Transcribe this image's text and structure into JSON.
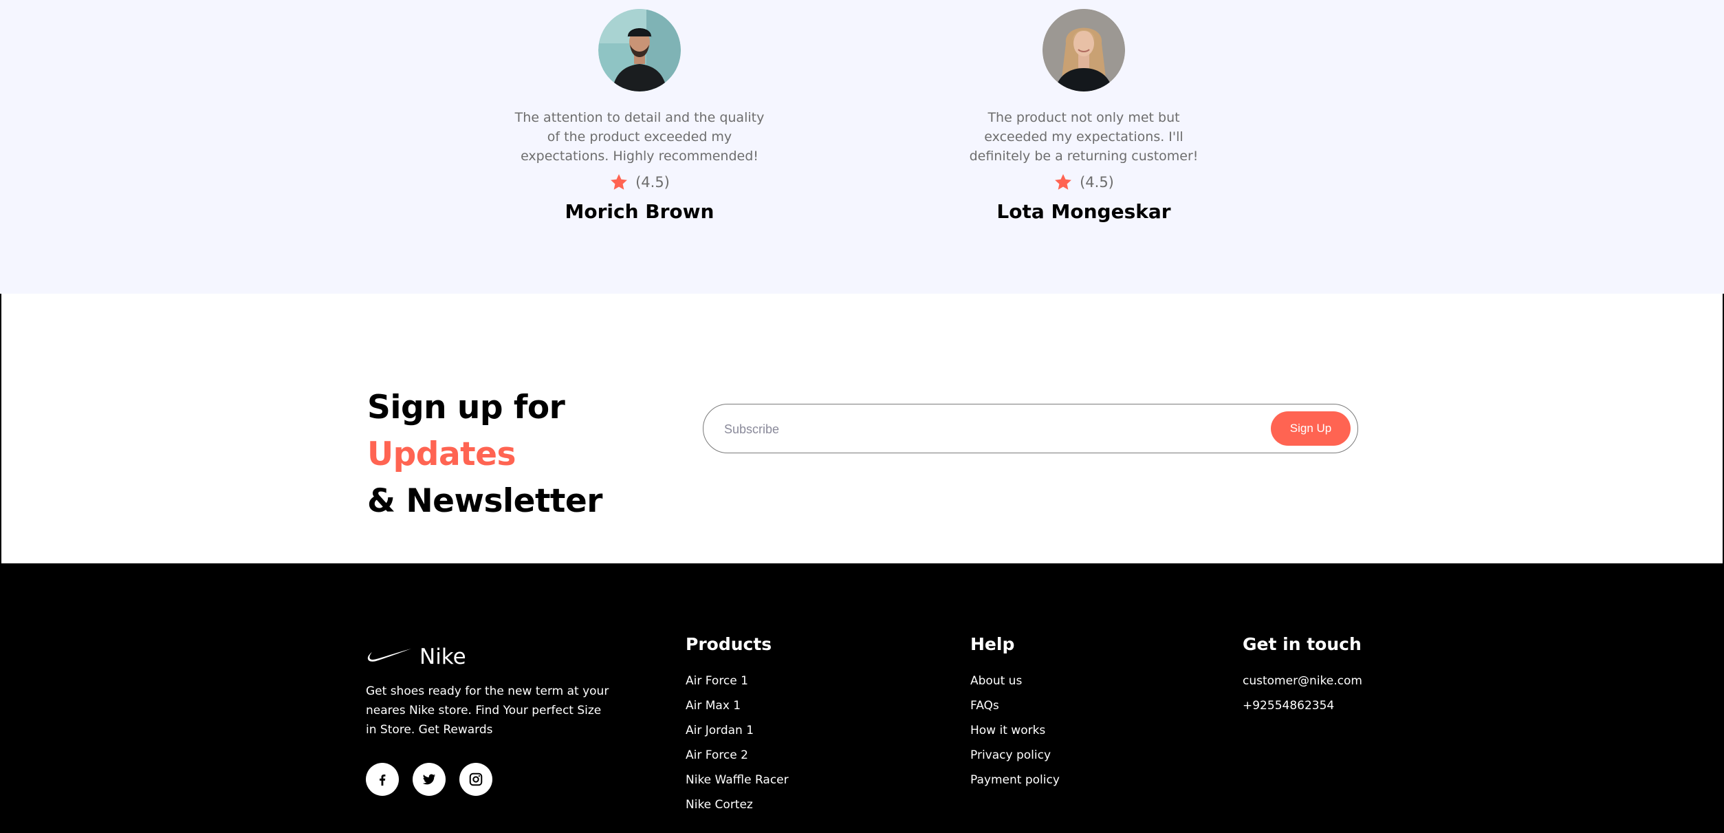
{
  "colors": {
    "accent": "#ff6452",
    "reviews_bg": "#f5f6ff",
    "footer_bg": "#000000",
    "star": "#ff6452"
  },
  "reviews": [
    {
      "avatar": "avatar-man-cap",
      "text": "The attention to detail and the quality of the product exceeded my expectations. Highly recommended!",
      "rating": "(4.5)",
      "name": "Morich Brown"
    },
    {
      "avatar": "avatar-woman-blonde",
      "text": "The product not only met but exceeded my expectations. I'll definitely be a returning customer!",
      "rating": "(4.5)",
      "name": "Lota Mongeskar"
    }
  ],
  "newsletter": {
    "title_part1": "Sign up for ",
    "title_accent": "Updates",
    "title_part2": "& Newsletter",
    "input_placeholder": "Subscribe",
    "button_label": "Sign Up"
  },
  "footer": {
    "brand_name": "Nike",
    "brand_icon": "swoosh-icon",
    "description": "Get shoes ready for the new term at your neares Nike store. Find Your perfect Size in Store. Get Rewards",
    "socials": [
      "facebook-icon",
      "twitter-icon",
      "instagram-icon"
    ],
    "columns": {
      "products": {
        "title": "Products",
        "links": [
          "Air Force 1",
          "Air Max 1",
          "Air Jordan 1",
          "Air Force 2",
          "Nike Waffle Racer",
          "Nike Cortez"
        ]
      },
      "help": {
        "title": "Help",
        "links": [
          "About us",
          "FAQs",
          "How it works",
          "Privacy policy",
          "Payment policy"
        ]
      },
      "contact": {
        "title": "Get in touch",
        "links": [
          "customer@nike.com",
          "+92554862354"
        ]
      }
    }
  }
}
